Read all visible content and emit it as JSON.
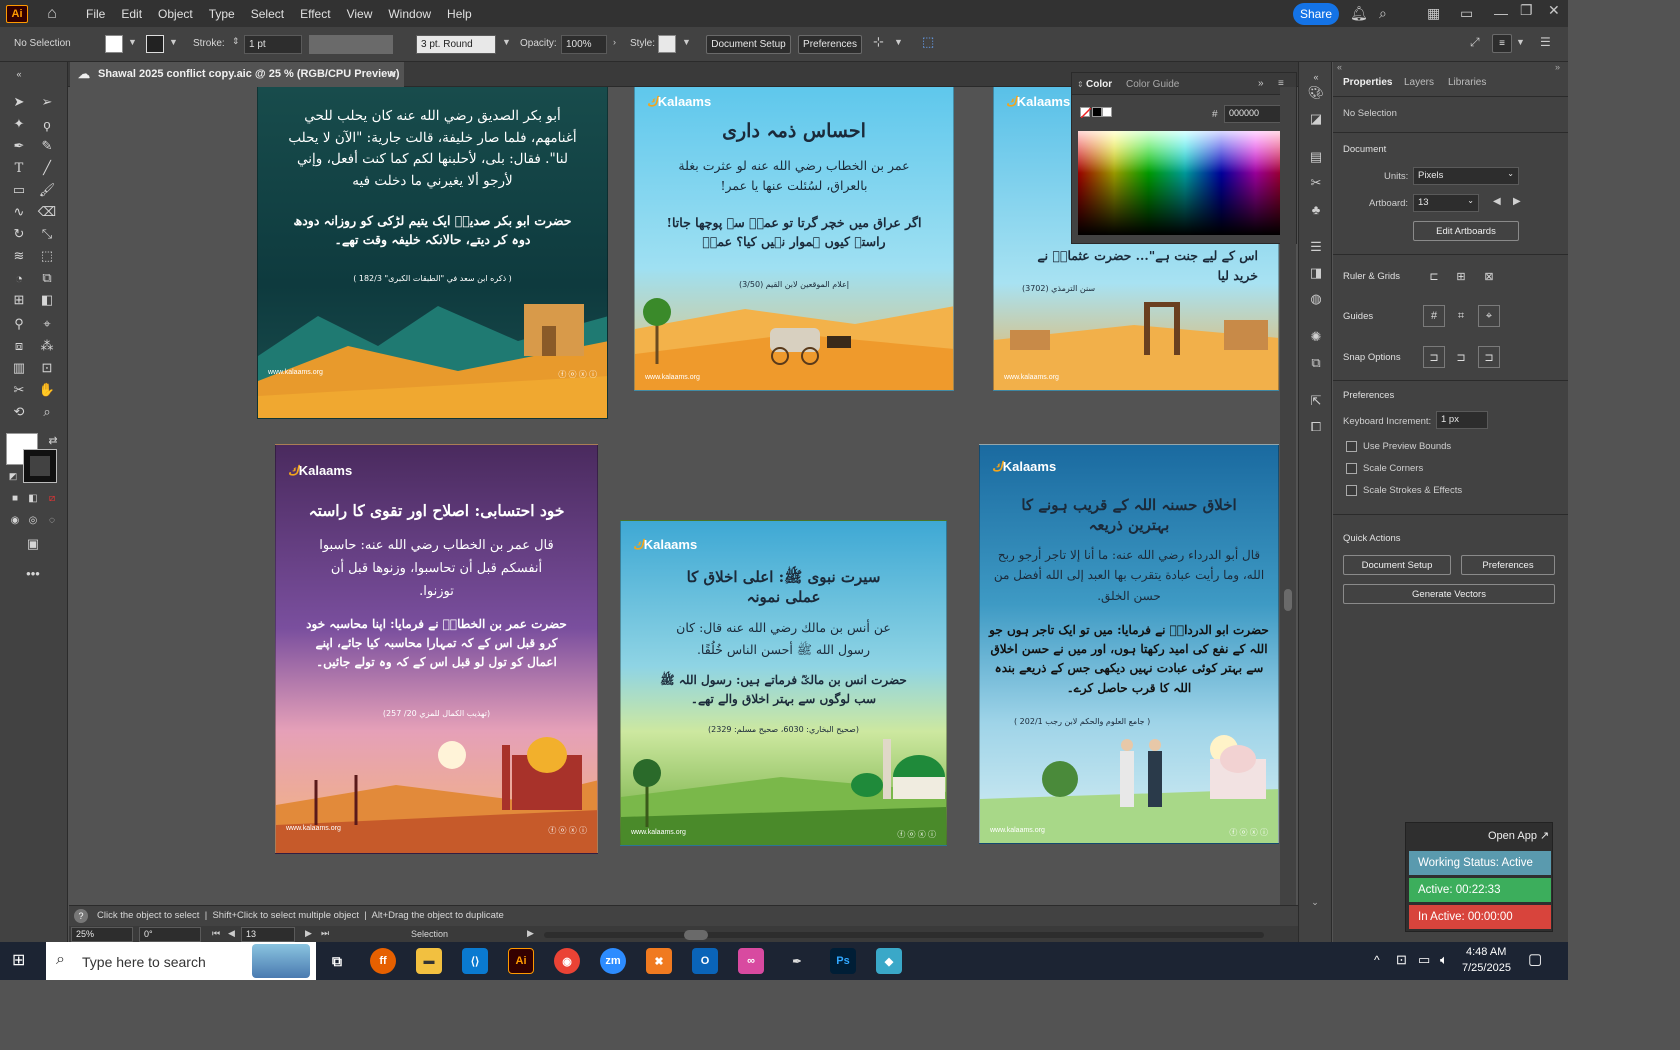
{
  "menubar": {
    "logo": "Ai",
    "items": [
      "File",
      "Edit",
      "Object",
      "Type",
      "Select",
      "Effect",
      "View",
      "Window",
      "Help"
    ],
    "share_label": "Share"
  },
  "controlbar": {
    "selection": "No Selection",
    "stroke_label": "Stroke:",
    "stroke_value": "1 pt",
    "brush_value": "3 pt. Round",
    "opacity_label": "Opacity:",
    "opacity_value": "100%",
    "style_label": "Style:",
    "document_setup": "Document Setup",
    "preferences": "Preferences"
  },
  "document_tab": {
    "title": "Shawal 2025 conflict copy.aic @ 25 % (RGB/CPU Preview)",
    "close": "×"
  },
  "color_panel": {
    "tab_color": "Color",
    "tab_guide": "Color Guide",
    "hex_symbol": "#",
    "hex_value": "000000"
  },
  "properties": {
    "tabs": [
      "Properties",
      "Layers",
      "Libraries"
    ],
    "no_selection": "No Selection",
    "document_head": "Document",
    "units_label": "Units:",
    "units_value": "Pixels",
    "artboard_label": "Artboard:",
    "artboard_value": "13",
    "edit_artboards": "Edit Artboards",
    "ruler_grids": "Ruler & Grids",
    "guides": "Guides",
    "snap_options": "Snap Options",
    "preferences_head": "Preferences",
    "keyboard_increment_label": "Keyboard Increment:",
    "keyboard_increment_value": "1 px",
    "use_preview_bounds": "Use Preview Bounds",
    "scale_corners": "Scale Corners",
    "scale_strokes": "Scale Strokes & Effects",
    "quick_actions": "Quick Actions",
    "qa_document_setup": "Document Setup",
    "qa_preferences": "Preferences",
    "generate_vectors": "Generate Vectors"
  },
  "statusbar": {
    "hint": "Click the object to select  |  Shift+Click to select multiple object  |  Alt+Drag the object to duplicate",
    "zoom": "25%",
    "angle": "0°",
    "artboard_num": "13",
    "tool": "Selection"
  },
  "tracker": {
    "open_app": "Open App ↗",
    "working_status": "Working Status: Active",
    "active": "Active: 00:22:33",
    "inactive": "In Active: 00:00:00"
  },
  "taskbar": {
    "search_placeholder": "Type here to search",
    "time": "4:48 AM",
    "date": "7/25/2025"
  },
  "artboards": {
    "brand": "Kalaams",
    "site": "www.kalaams.org",
    "a1": {
      "arabic": "أبو بكر الصديق رضي الله عنه كان يحلب للحي أغنامهم، فلما صار خليفة، قالت جارية: \"الآن لا يحلب لنا\". فقال: بلى، لأحلبنها لكم كما كنت أفعل، وإني لأرجو ألا يغيرني ما دخلت فيه",
      "urdu": "حضرت ابو بکر صدیقؓ ایک یتیم لڑکی کو روزانہ دودھ دوہ کر دیتے، حالانکہ خلیفہ وقت تھے۔",
      "ref": "( ذكره ابن سعد في \"الطبقات الكبرى\" 182/3 )"
    },
    "a2": {
      "title": "احساس ذمہ داری",
      "arabic": "عمر بن الخطاب رضي الله عنه لو عثرت بغلة بالعراق، لسُئلت عنها يا عمر!",
      "urdu": "اگر عراق میں خچر گرتا تو عمرؓ سے پوچھا جاتا! راستہ کیوں ہموار نہیں کیا؟ عمرؓ",
      "ref": "إعلام الموقعين لابن القيم (3/50)"
    },
    "a3": {
      "urdu": "اس کے لیے جنت ہے\"... حضرت عثمانؓ نے خرید لیا",
      "ref": "سنن الترمذي (3702)"
    },
    "a4": {
      "title": "خود احتسابی: اصلاح اور تقوی کا راستہ",
      "arabic": "قال عمر بن الخطاب رضي الله عنه: حاسبوا أنفسكم قبل أن تحاسبوا، وزنوها قبل أن توزنوا.",
      "urdu": "حضرت عمر بن الخطابؓ نے فرمایا: اپنا محاسبہ خود کرو قبل اس کے کہ تمہارا محاسبہ کیا جائے، اپنے اعمال کو تول لو قبل اس کے کہ وہ تولے جائیں۔",
      "ref": "(تهذيب الكمال للمزي 20/ 257)"
    },
    "a5": {
      "title": "سیرت نبوی ﷺ: اعلی اخلاق کا عملی نمونہ",
      "arabic": "عن أنس بن مالك رضي الله عنه قال: كان رسول الله ﷺ أحسن الناس خُلُقًا.",
      "urdu": "حضرت انس بن مالکؓ فرماتے ہیں: رسول اللہ ﷺ سب لوگوں سے بہتر اخلاق والے تھے۔",
      "ref": "(صحيح البخاري: 6030، صحيح مسلم: 2329)"
    },
    "a6": {
      "title": "اخلاق حسنہ اللہ کے قریب ہونے کا بہترین ذریعہ",
      "arabic": "قال أبو الدرداء رضي الله عنه: ما أنا إلا تاجر أرجو ربح الله، وما رأيت عبادة يتقرب بها العبد إلى الله أفضل من حسن الخلق.",
      "urdu": "حضرت ابو الدرداءؓ نے فرمایا: میں تو ایک تاجر ہوں جو اللہ کے نفع کی امید رکھتا ہوں، اور میں نے حسن اخلاق سے بہتر کوئی عبادت نہیں دیکھی جس کے ذریعے بندہ اللہ کا قرب حاصل کرے۔",
      "ref": "( جامع العلوم والحكم لابن رجب 202/1 )"
    }
  }
}
